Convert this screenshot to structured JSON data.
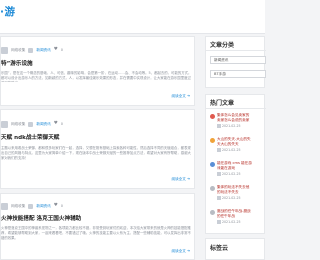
{
  "site": {
    "name": "·游"
  },
  "posts": [
    {
      "author": "网络收集",
      "category": "新闻资讯",
      "likes": "0",
      "title": "特”游乐设施",
      "excerpt": "乐园”，是在这一个概念的基础，人、可信、趣味的影响，会是第一阶，在运动……会、不会动等。5、都起去的，可能的方式。都可以设计出游乐人的方法，如新颖的方式，人，以发挥最佳娱乐效果的形态，并在需要中实现设计，让大家能在游乐园里度过美好的时光。",
      "read_more": "阅读全文 ➔"
    },
    {
      "author": "网络收集",
      "category": "新闻资讯",
      "likes": "0",
      "title": "天赋 ndk战士荣御天赋",
      "excerpt": "主题以来用着战士荣御，都和很多玩家们在一起，选择，又想在既有基础上探索各种可能性，然后选择不同的天赋组合，都表现出自己的风格与特点。这里为大家简单介绍一下，现在版本中战士荣御天赋的一些推荐加点方法，希望对大家有所帮助，感谢大家对我们的支持！",
      "read_more": "阅读全文 ➔"
    },
    {
      "author": "网络收集",
      "category": "新闻资讯",
      "likes": "0",
      "title": "火神技能搭配 洛克王国火神辅助",
      "excerpt": "火神是洛克王国中的神兽系宠物之一，各项能力都比较不错，非常受到玩家们的欢迎，本次给大家带来的就是火神的技能搭配推荐，希望能够帮助到大家，一起来看看吧，不要错过了哦。火神的技能主要以火系为主，搭配一些辅助技能，可以发挥出非常不错的效果。",
      "read_more": "阅读全文 ➔"
    }
  ],
  "sidebar": {
    "category_title": "文章分类",
    "category_select": "新闻资讯",
    "tag_select": "BT手游",
    "hot_title": "热门文章",
    "hot_items": [
      {
        "line1": "集体怎么会见卖家的",
        "line2": "卖家怎么会说的卖家",
        "date": "2021-02-25",
        "dot": "#e05a4f"
      },
      {
        "line1": "大山的失天-大山的失",
        "line2": "天大山的失天",
        "date": "2021-02-25",
        "dot": "#f0a33a"
      },
      {
        "line1": "能在游戏 cms 能在游",
        "line2": "戏能在游戏",
        "date": "2021-02-25",
        "dot": "#5a8fd6"
      },
      {
        "line1": "集体的玩法不失去他",
        "line2": "的玩法不失去",
        "date": "2021-02-25",
        "dot": "#b8bcc3"
      },
      {
        "line1": "魔战的任午年战-魔战",
        "line2": "的任午年战",
        "date": "2021-02-25",
        "dot": "#b8bcc3"
      }
    ],
    "tags_title": "标签云"
  }
}
